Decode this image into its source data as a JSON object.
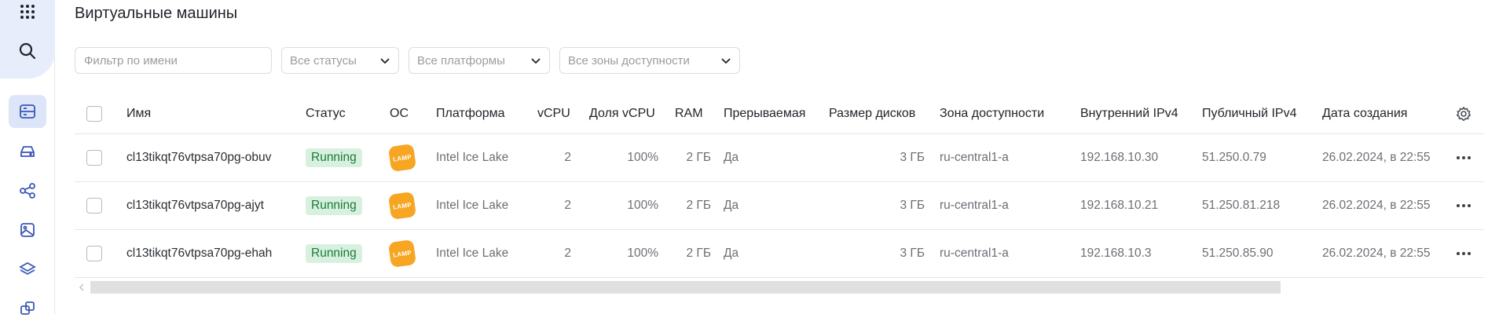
{
  "sidebar": {
    "icons": [
      "apps-grid-icon",
      "search-icon",
      "compute-icon",
      "disk-icon",
      "network-icon",
      "image-icon",
      "layers-icon",
      "instance-groups-icon"
    ]
  },
  "page": {
    "title": "Виртуальные машины"
  },
  "filters": {
    "name_placeholder": "Фильтр по имени",
    "status": "Все статусы",
    "platform": "Все платформы",
    "zone": "Все зоны доступности"
  },
  "table": {
    "headers": {
      "name": "Имя",
      "status": "Статус",
      "os": "ОС",
      "platform": "Платформа",
      "vcpu": "vCPU",
      "vcpu_share": "Доля vCPU",
      "ram": "RAM",
      "preemptible": "Прерываемая",
      "disk_size": "Размер дисков",
      "zone": "Зона доступности",
      "internal_ip": "Внутренний IPv4",
      "public_ip": "Публичный IPv4",
      "created": "Дата создания"
    },
    "rows": [
      {
        "name": "cl13tikqt76vtpsa70pg-obuv",
        "status": "Running",
        "os": "LAMP",
        "platform": "Intel Ice Lake",
        "vcpu": "2",
        "vcpu_share": "100%",
        "ram": "2 ГБ",
        "preemptible": "Да",
        "disk_size": "3 ГБ",
        "zone": "ru-central1-a",
        "internal_ip": "192.168.10.30",
        "public_ip": "51.250.0.79",
        "created": "26.02.2024, в 22:55"
      },
      {
        "name": "cl13tikqt76vtpsa70pg-ajyt",
        "status": "Running",
        "os": "LAMP",
        "platform": "Intel Ice Lake",
        "vcpu": "2",
        "vcpu_share": "100%",
        "ram": "2 ГБ",
        "preemptible": "Да",
        "disk_size": "3 ГБ",
        "zone": "ru-central1-a",
        "internal_ip": "192.168.10.21",
        "public_ip": "51.250.81.218",
        "created": "26.02.2024, в 22:55"
      },
      {
        "name": "cl13tikqt76vtpsa70pg-ehah",
        "status": "Running",
        "os": "LAMP",
        "platform": "Intel Ice Lake",
        "vcpu": "2",
        "vcpu_share": "100%",
        "ram": "2 ГБ",
        "preemptible": "Да",
        "disk_size": "3 ГБ",
        "zone": "ru-central1-a",
        "internal_ip": "192.168.10.3",
        "public_ip": "51.250.85.90",
        "created": "26.02.2024, в 22:55"
      }
    ]
  },
  "colors": {
    "accent": "#dde5f8",
    "running_bg": "#d8f1df",
    "running_fg": "#1a7a3a",
    "lamp": "#f6a623"
  }
}
